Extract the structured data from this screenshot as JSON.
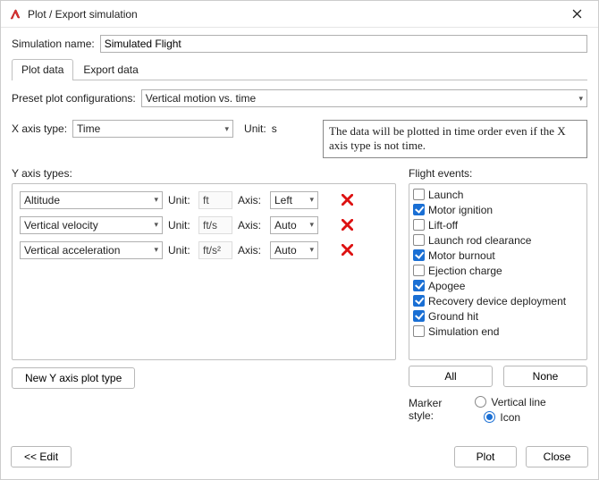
{
  "window": {
    "title": "Plot / Export simulation"
  },
  "labels": {
    "simulation_name": "Simulation name:",
    "preset": "Preset plot configurations:",
    "x_axis_type": "X axis type:",
    "x_unit": "Unit:",
    "y_axis_types": "Y axis types:",
    "flight_events": "Flight events:",
    "marker_style": "Marker style:",
    "unit": "Unit:",
    "axis": "Axis:"
  },
  "simulation_name_value": "Simulated Flight",
  "tabs": [
    {
      "label": "Plot data",
      "active": true
    },
    {
      "label": "Export data",
      "active": false
    }
  ],
  "preset_value": "Vertical motion vs. time",
  "x_axis": {
    "type": "Time",
    "unit": "s"
  },
  "note": "The data will be plotted in time order even if the X axis type is not time.",
  "y_axes": [
    {
      "type": "Altitude",
      "unit": "ft",
      "axis": "Left"
    },
    {
      "type": "Vertical velocity",
      "unit": "ft/s",
      "axis": "Auto"
    },
    {
      "type": "Vertical acceleration",
      "unit": "ft/s²",
      "axis": "Auto"
    }
  ],
  "events": [
    {
      "label": "Launch",
      "checked": false
    },
    {
      "label": "Motor ignition",
      "checked": true
    },
    {
      "label": "Lift-off",
      "checked": false
    },
    {
      "label": "Launch rod clearance",
      "checked": false
    },
    {
      "label": "Motor burnout",
      "checked": true
    },
    {
      "label": "Ejection charge",
      "checked": false
    },
    {
      "label": "Apogee",
      "checked": true
    },
    {
      "label": "Recovery device deployment",
      "checked": true
    },
    {
      "label": "Ground hit",
      "checked": true
    },
    {
      "label": "Simulation end",
      "checked": false
    }
  ],
  "buttons": {
    "all": "All",
    "none": "None",
    "new_y": "New Y axis plot type",
    "edit": "<< Edit",
    "plot": "Plot",
    "close": "Close"
  },
  "marker": {
    "options": [
      "Vertical line",
      "Icon"
    ],
    "selected": 1
  }
}
